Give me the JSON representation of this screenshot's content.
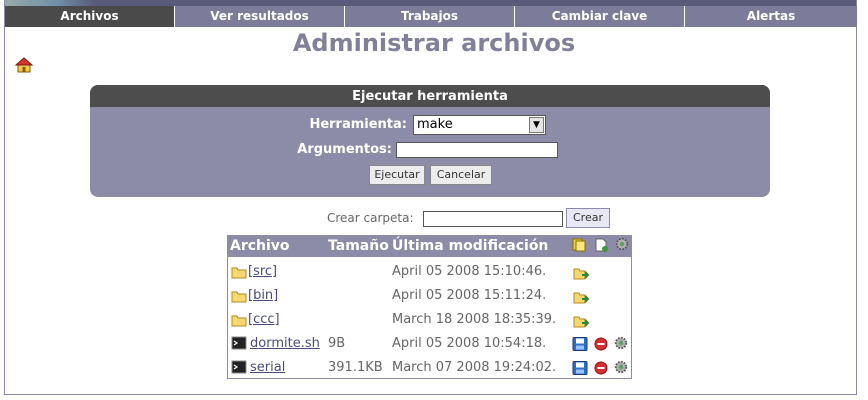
{
  "nav": {
    "tabs": [
      {
        "label": "Archivos",
        "active": true
      },
      {
        "label": "Ver resultados",
        "active": false
      },
      {
        "label": "Trabajos",
        "active": false
      },
      {
        "label": "Cambiar clave",
        "active": false
      },
      {
        "label": "Alertas",
        "active": false
      }
    ]
  },
  "page": {
    "title": "Administrar archivos"
  },
  "tool_panel": {
    "heading": "Ejecutar herramienta",
    "tool_label": "Herramienta:",
    "tool_value": "make",
    "args_label": "Argumentos:",
    "args_value": "",
    "run_label": "Ejecutar",
    "cancel_label": "Cancelar"
  },
  "mkdir": {
    "label": "Crear carpeta:",
    "value": "",
    "button_label": "Crear"
  },
  "files": {
    "headers": {
      "name": "Archivo",
      "size": "Tamaño",
      "modified": "Última modificación"
    },
    "rows": [
      {
        "type": "folder",
        "name": "[src]",
        "size": "",
        "modified": "April 05 2008 15:10:46."
      },
      {
        "type": "folder",
        "name": "[bin]",
        "size": "",
        "modified": "April 05 2008 15:11:24."
      },
      {
        "type": "folder",
        "name": "[ccc]",
        "size": "",
        "modified": "March 18 2008 18:35:39."
      },
      {
        "type": "file",
        "name": "dormite.sh",
        "size": "9B",
        "modified": "April 05 2008 10:54:18."
      },
      {
        "type": "file",
        "name": "serial",
        "size": "391.1KB",
        "modified": "March 07 2008 19:24:02."
      }
    ]
  },
  "colors": {
    "nav_tab": "#7c7c9a",
    "nav_active": "#4a4a4a",
    "panel": "#8c8ca8",
    "title": "#80809a"
  }
}
